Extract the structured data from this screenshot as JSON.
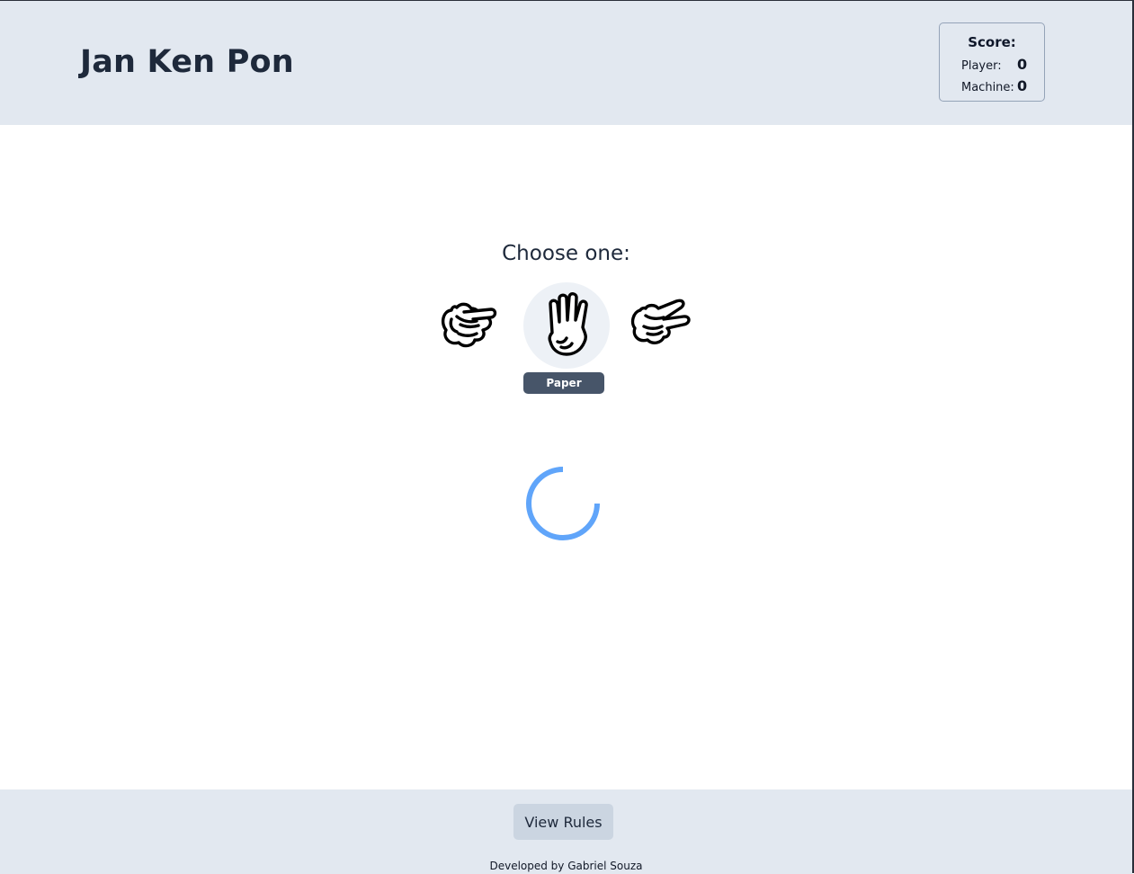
{
  "header": {
    "title": "Jan Ken Pon",
    "score": {
      "title": "Score:",
      "player_label": "Player:",
      "player_value": "0",
      "machine_label": "Machine:",
      "machine_value": "0"
    }
  },
  "main": {
    "prompt": "Choose one:",
    "choices": [
      {
        "name": "Rock",
        "icon": "rock-hand-icon"
      },
      {
        "name": "Paper",
        "icon": "paper-hand-icon",
        "hovered": true
      },
      {
        "name": "Scissors",
        "icon": "scissors-hand-icon"
      }
    ],
    "hover_label": "Paper",
    "loading": true,
    "spinner_color": "#60a5fa"
  },
  "footer": {
    "rules_button": "View Rules",
    "credit": "Developed by Gabriel Souza"
  },
  "colors": {
    "header_bg": "#e2e8f0",
    "tag_bg": "#475569",
    "button_bg": "#cbd5e1"
  }
}
